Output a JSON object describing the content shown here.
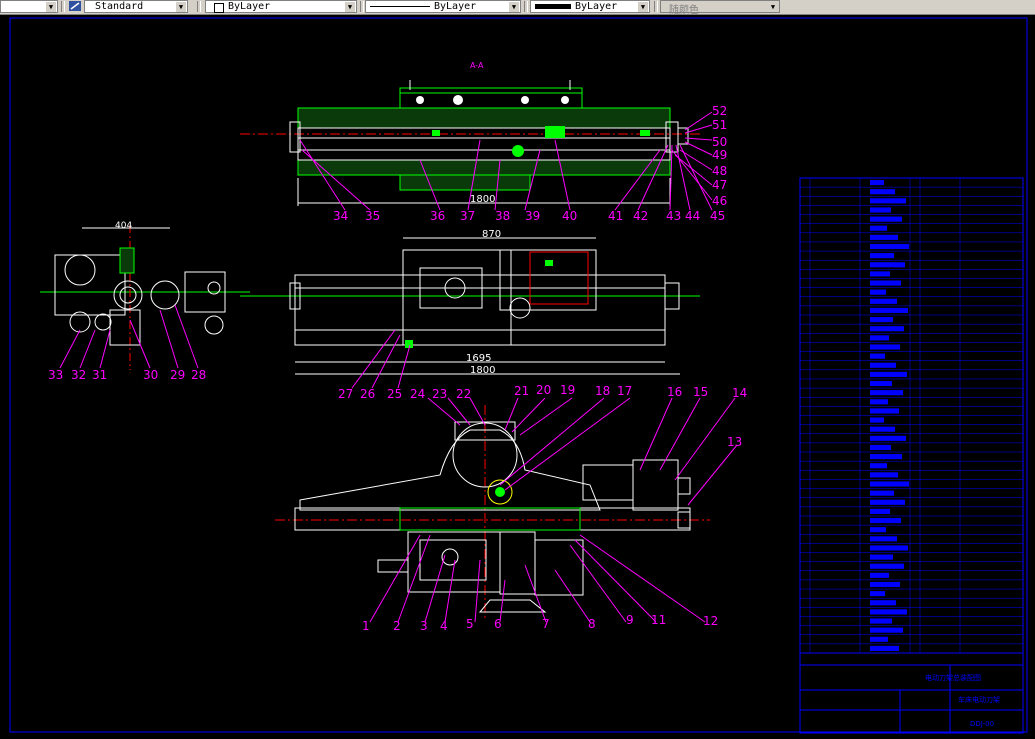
{
  "toolbar": {
    "style_label": "Standard",
    "layer_label": "ByLayer",
    "linetype_label": "ByLayer",
    "lineweight_label": "ByLayer",
    "color_label": "随颜色"
  },
  "drawing": {
    "section_title": "A-A",
    "dims": {
      "top_overall": "1800",
      "mid_width": "870",
      "mid_inner": "1695",
      "mid_overall": "1800",
      "side_width": "404"
    },
    "callouts_top": [
      "34",
      "35",
      "36",
      "37",
      "38",
      "39",
      "40",
      "41",
      "42",
      "43",
      "44",
      "45",
      "52",
      "51",
      "50",
      "49",
      "48",
      "47",
      "46"
    ],
    "callouts_mid": [
      "33",
      "32",
      "31",
      "30",
      "29",
      "28",
      "27",
      "26",
      "25"
    ],
    "callouts_bottom_top": [
      "24",
      "23",
      "22",
      "21",
      "20",
      "19",
      "18",
      "17",
      "16",
      "15",
      "14",
      "13"
    ],
    "callouts_bottom": [
      "1",
      "2",
      "3",
      "4",
      "5",
      "6",
      "7",
      "8",
      "9",
      "11",
      "12"
    ],
    "title_block_title": "电动刀架总装配图",
    "title_block_subtitle": "车床电动刀架",
    "title_block_code": "DDJ-00"
  },
  "colors": {
    "frame": "#0000ff",
    "outline": "#ffffff",
    "hatch": "#00ff00",
    "center": "#ff0000",
    "callout": "#ff00ff",
    "accent": "#ffff00"
  }
}
